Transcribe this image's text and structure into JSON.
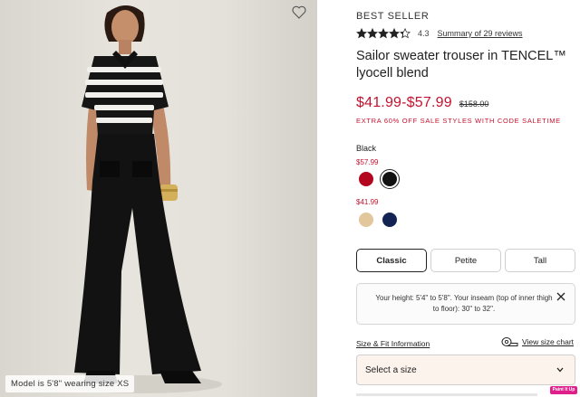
{
  "image": {
    "favorite_icon": "heart-outline-icon",
    "caption": "Model is 5'8\" wearing size XS"
  },
  "product": {
    "badge": "BEST SELLER",
    "rating": 4.3,
    "rating_label": "4.3",
    "reviews_link": "Summary of 29 reviews",
    "title": "Sailor sweater trouser in TENCEL™ lyocell blend",
    "price_range": "$41.99-$57.99",
    "original_price": "$158.00",
    "promo": "EXTRA 60% OFF SALE STYLES WITH CODE SALETIME"
  },
  "colors": {
    "selected_name": "Black",
    "groups": [
      {
        "price": "$57.99",
        "swatches": [
          {
            "name": "red",
            "hex": "#b3061f",
            "selected": false
          },
          {
            "name": "black",
            "hex": "#111111",
            "selected": true
          }
        ]
      },
      {
        "price": "$41.99",
        "swatches": [
          {
            "name": "tan",
            "hex": "#e3c79c",
            "selected": false
          },
          {
            "name": "navy",
            "hex": "#142452",
            "selected": false
          }
        ]
      }
    ]
  },
  "size_tabs": [
    {
      "label": "Classic",
      "active": true
    },
    {
      "label": "Petite",
      "active": false
    },
    {
      "label": "Tall",
      "active": false
    }
  ],
  "fit_note": {
    "text": "Your height: 5'4\" to 5'8\". Your inseam (top of inner thigh to floor): 30\" to 32\".",
    "close_icon": "close-icon"
  },
  "links": {
    "size_fit": "Size & Fit Information",
    "size_chart": "View size chart",
    "size_chart_icon": "tape-measure-icon"
  },
  "select": {
    "label": "Select a size",
    "icon": "chevron-down-icon"
  },
  "overlay_badge": "Paint It Up",
  "colors_theme": {
    "sale_red": "#c4122e",
    "select_bg": "#fcf3ec"
  }
}
